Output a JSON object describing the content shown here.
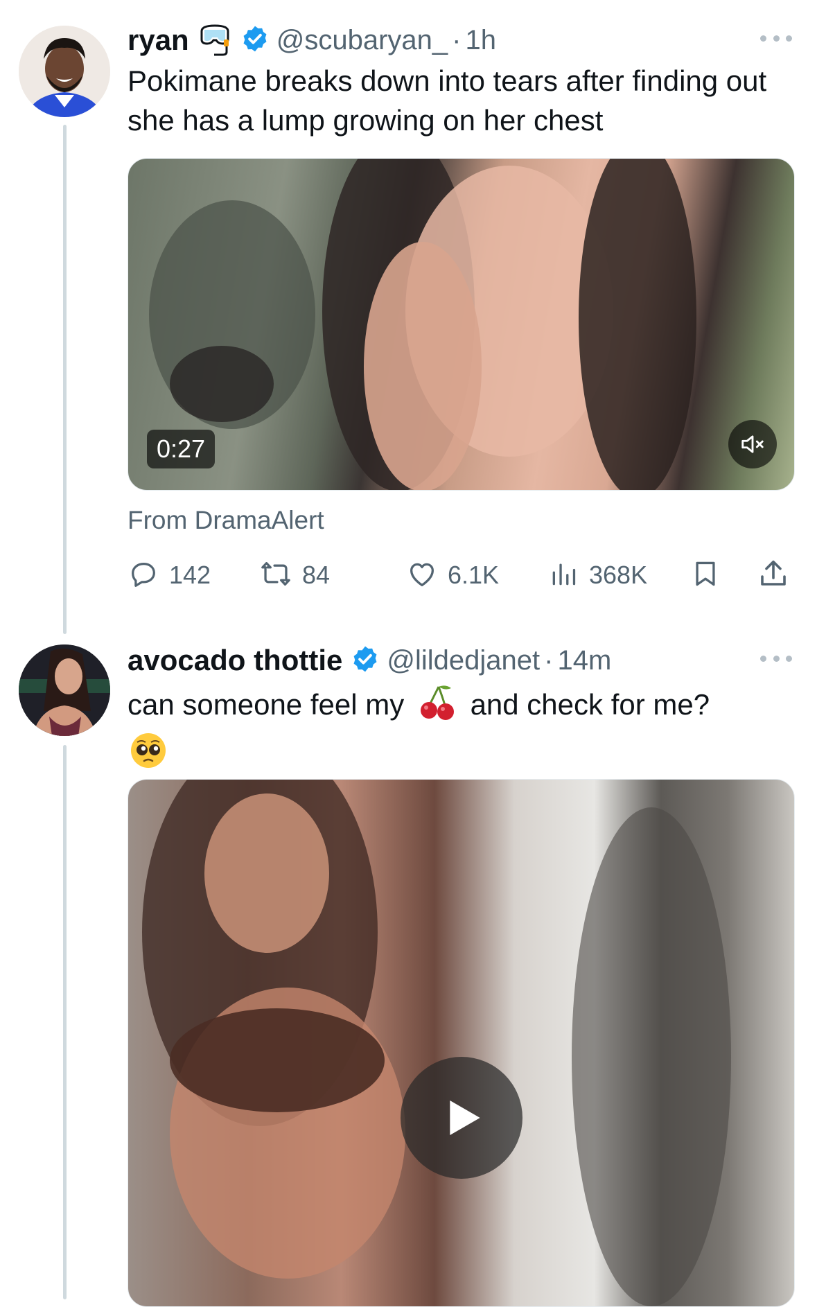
{
  "tweets": [
    {
      "name": "ryan",
      "handle": "@scubaryan_",
      "separator": "·",
      "time": "1h",
      "text": "Pokimane breaks down into tears after finding out she has a lump growing on her chest",
      "video_duration": "0:27",
      "source": "From DramaAlert",
      "stats": {
        "replies": "142",
        "reposts": "84",
        "likes": "6.1K",
        "views": "368K"
      }
    },
    {
      "name": "avocado thottie",
      "handle": "@lildedjanet",
      "separator": "·",
      "time": "14m",
      "text_before_emoji": "can someone feel my",
      "text_after_emoji": "and check for me?",
      "emojis": [
        "cherries",
        "pleading-face"
      ]
    }
  ],
  "icons": {
    "verified_color": "#1d9bf0",
    "name_emoji": "diving-mask",
    "reply": "reply-icon",
    "repost": "repost-icon",
    "like": "heart-icon",
    "views": "views-icon",
    "bookmark": "bookmark-icon",
    "share": "share-icon"
  }
}
